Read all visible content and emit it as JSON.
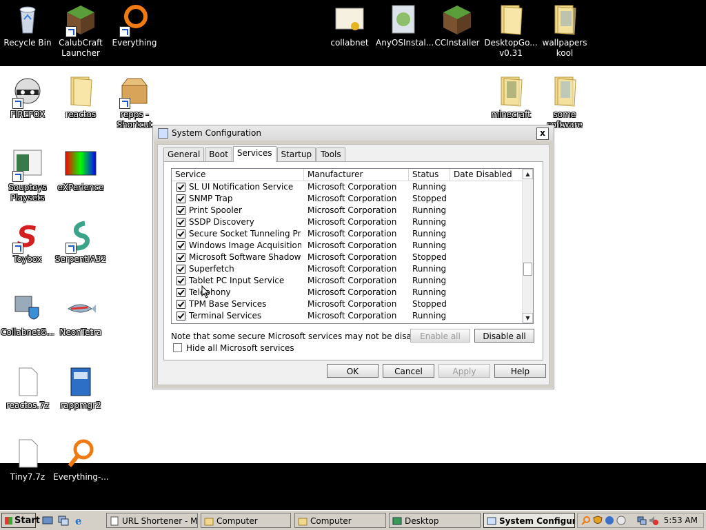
{
  "desktop": {
    "top_icons": [
      {
        "label": "Recycle Bin"
      },
      {
        "label": "CalubCraft Launcher"
      },
      {
        "label": "Everything"
      },
      {
        "label": "collabnet"
      },
      {
        "label": "AnyOSInstal..."
      },
      {
        "label": "CCInstaller"
      },
      {
        "label": "DesktopGo... v0.31"
      },
      {
        "label": "wallpapers kool"
      }
    ],
    "icons": [
      {
        "label": "FIREFOX"
      },
      {
        "label": "reactos"
      },
      {
        "label": "repps - Shortcut"
      },
      {
        "label": "minecraft"
      },
      {
        "label": "some software"
      },
      {
        "label": "Souptoys Playsets"
      },
      {
        "label": "eXPerience"
      },
      {
        "label": "Toybox"
      },
      {
        "label": "SerpentIA32"
      },
      {
        "label": "CollabnetG..."
      },
      {
        "label": "NeonTetra"
      },
      {
        "label": "reactos.7z"
      },
      {
        "label": "rappmgr2"
      },
      {
        "label": "Tiny7.7z"
      },
      {
        "label": "Everything-..."
      }
    ]
  },
  "dialog": {
    "title": "System Configuration",
    "close_glyph": "x",
    "tabs": [
      "General",
      "Boot",
      "Services",
      "Startup",
      "Tools"
    ],
    "active_tab": "Services",
    "columns": [
      "Service",
      "Manufacturer",
      "Status",
      "Date Disabled"
    ],
    "rows": [
      {
        "service": "SL UI Notification Service",
        "manufacturer": "Microsoft Corporation",
        "status": "Running",
        "date": ""
      },
      {
        "service": "SNMP Trap",
        "manufacturer": "Microsoft Corporation",
        "status": "Stopped",
        "date": ""
      },
      {
        "service": "Print Spooler",
        "manufacturer": "Microsoft Corporation",
        "status": "Running",
        "date": ""
      },
      {
        "service": "SSDP Discovery",
        "manufacturer": "Microsoft Corporation",
        "status": "Running",
        "date": ""
      },
      {
        "service": "Secure Socket Tunneling Protoc...",
        "manufacturer": "Microsoft Corporation",
        "status": "Running",
        "date": ""
      },
      {
        "service": "Windows Image Acquisition (WIA)",
        "manufacturer": "Microsoft Corporation",
        "status": "Running",
        "date": ""
      },
      {
        "service": "Microsoft Software Shadow Co...",
        "manufacturer": "Microsoft Corporation",
        "status": "Stopped",
        "date": ""
      },
      {
        "service": "Superfetch",
        "manufacturer": "Microsoft Corporation",
        "status": "Running",
        "date": ""
      },
      {
        "service": "Tablet PC Input Service",
        "manufacturer": "Microsoft Corporation",
        "status": "Running",
        "date": ""
      },
      {
        "service": "Telephony",
        "manufacturer": "Microsoft Corporation",
        "status": "Running",
        "date": ""
      },
      {
        "service": "TPM Base Services",
        "manufacturer": "Microsoft Corporation",
        "status": "Stopped",
        "date": ""
      },
      {
        "service": "Terminal Services",
        "manufacturer": "Microsoft Corporation",
        "status": "Running",
        "date": ""
      }
    ],
    "note": "Note that some secure Microsoft services may not be disabled.",
    "enable_all": "Enable all",
    "disable_all": "Disable all",
    "hide_ms": "Hide all Microsoft services",
    "ok": "OK",
    "cancel": "Cancel",
    "apply": "Apply",
    "help": "Help"
  },
  "taskbar": {
    "start": "Start",
    "tasks": [
      {
        "label": "URL Shortener - M..."
      },
      {
        "label": "Computer"
      },
      {
        "label": "Computer"
      },
      {
        "label": "Desktop"
      },
      {
        "label": "System Configur..."
      }
    ],
    "clock": "5:53 AM"
  },
  "colors": {
    "desktop_band": "#000000",
    "desktop_bg": "#ffffff",
    "dialog_face": "#d4d0c8"
  }
}
